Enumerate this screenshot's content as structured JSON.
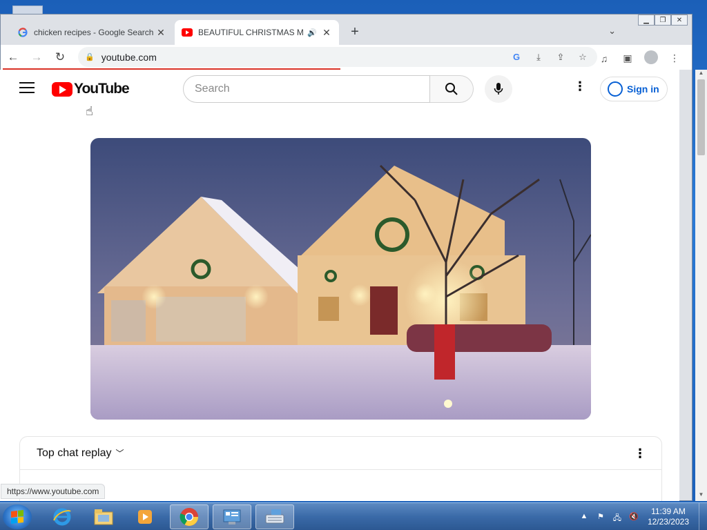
{
  "browser": {
    "tabs": [
      {
        "title": "chicken recipes - Google Search",
        "favicon": "google-g-icon",
        "active": false
      },
      {
        "title": "BEAUTIFUL CHRISTMAS MUS",
        "favicon": "youtube-icon",
        "active": true,
        "audio": "speaker-icon"
      }
    ],
    "new_tab": "+",
    "tab_search": "⌄",
    "url": "youtube.com",
    "status_url": "https://www.youtube.com"
  },
  "youtube": {
    "logo_text": "YouTube",
    "search_placeholder": "Search",
    "signin_label": "Sign in",
    "chat_title": "Top chat replay"
  },
  "taskbar": {
    "apps": [
      "internet-explorer-icon",
      "file-explorer-icon",
      "media-player-icon",
      "chrome-icon",
      "control-panel-icon",
      "on-screen-keyboard-icon"
    ],
    "time": "11:39 AM",
    "date": "12/23/2023"
  },
  "colors": {
    "yt_red": "#ff0000",
    "link_blue": "#065fd4",
    "loading_red": "#d93025"
  }
}
